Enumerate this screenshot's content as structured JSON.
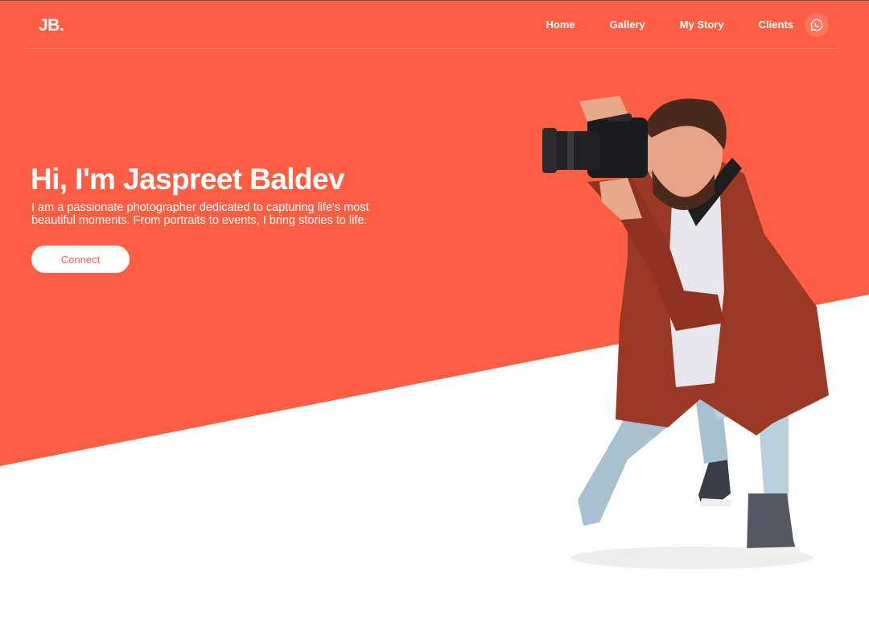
{
  "brand": {
    "logo": "JB."
  },
  "nav": {
    "items": [
      {
        "label": "Home"
      },
      {
        "label": "Gallery"
      },
      {
        "label": "My Story"
      },
      {
        "label": "Clients"
      }
    ],
    "whatsapp_icon": "whatsapp-icon"
  },
  "hero": {
    "greeting": "Hi, I'm ",
    "name": "Jaspreet Baldev",
    "description": "I am a passionate photographer dedicated to capturing life's most beautiful moments. From portraits to events, I bring stories to life.",
    "cta_label": "Connect",
    "image": "photographer-with-camera"
  },
  "colors": {
    "accent": "#fe5e44",
    "background": "#ffffff",
    "text_on_accent": "#ffffff"
  }
}
